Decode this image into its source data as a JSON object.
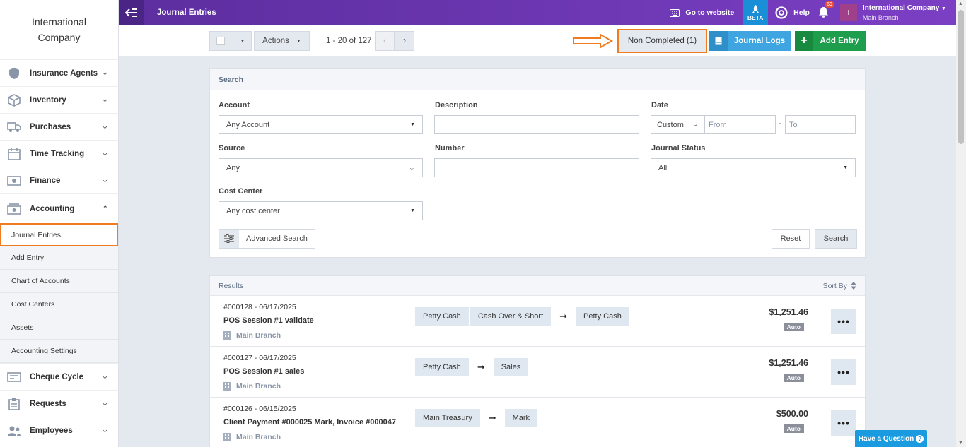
{
  "brand": {
    "line1": "International",
    "line2": "Company"
  },
  "sidebar": {
    "items_before": [
      {
        "label": "Insurance Agents",
        "icon": "shield-icon"
      },
      {
        "label": "Inventory",
        "icon": "box-icon"
      },
      {
        "label": "Purchases",
        "icon": "truck-icon"
      },
      {
        "label": "Time Tracking",
        "icon": "calendar-icon"
      },
      {
        "label": "Finance",
        "icon": "money-icon"
      }
    ],
    "accounting": {
      "label": "Accounting",
      "icon": "accounting-icon"
    },
    "sub_items": [
      "Journal Entries",
      "Add Entry",
      "Chart of Accounts",
      "Cost Centers",
      "Assets",
      "Accounting Settings"
    ],
    "items_after": [
      {
        "label": "Cheque Cycle",
        "icon": "cheque-icon"
      },
      {
        "label": "Requests",
        "icon": "clipboard-icon"
      },
      {
        "label": "Employees",
        "icon": "users-icon"
      }
    ]
  },
  "topbar": {
    "title": "Journal Entries",
    "go_to_website": "Go to website",
    "beta": "BETA",
    "help": "Help",
    "notifications_count": "69",
    "user_initial": "I",
    "user_name": "International Company",
    "user_branch": "Main Branch"
  },
  "toolbar": {
    "actions": "Actions",
    "pager": "1 - 20 of 127",
    "non_completed": "Non Completed (1)",
    "journal_logs": "Journal Logs",
    "add_entry": "Add Entry"
  },
  "search": {
    "title": "Search",
    "account_label": "Account",
    "account_value": "Any Account",
    "description_label": "Description",
    "description_value": "",
    "date_label": "Date",
    "date_mode": "Custom",
    "date_from_placeholder": "From",
    "date_sep": "-",
    "date_to_placeholder": "To",
    "source_label": "Source",
    "source_value": "Any",
    "number_label": "Number",
    "number_value": "",
    "status_label": "Journal Status",
    "status_value": "All",
    "cost_center_label": "Cost Center",
    "cost_center_value": "Any cost center",
    "advanced": "Advanced Search",
    "reset": "Reset",
    "search": "Search"
  },
  "results": {
    "title": "Results",
    "sort_by": "Sort By",
    "rows": [
      {
        "num": "#000128 - 06/17/2025",
        "desc": "POS Session #1 validate",
        "branch": "Main Branch",
        "from": [
          "Petty Cash",
          "Cash Over & Short"
        ],
        "to": [
          "Petty Cash"
        ],
        "amount": "$1,251.46",
        "tag": "Auto"
      },
      {
        "num": "#000127 - 06/17/2025",
        "desc": "POS Session #1 sales",
        "branch": "Main Branch",
        "from": [
          "Petty Cash"
        ],
        "to": [
          "Sales"
        ],
        "amount": "$1,251.46",
        "tag": "Auto"
      },
      {
        "num": "#000126 - 06/15/2025",
        "desc": "Client Payment #000025 Mark, Invoice #000047",
        "branch": "Main Branch",
        "from": [
          "Main Treasury"
        ],
        "to": [
          "Mark"
        ],
        "amount": "$500.00",
        "tag": "Auto"
      }
    ]
  },
  "help_button": "Have a Question"
}
